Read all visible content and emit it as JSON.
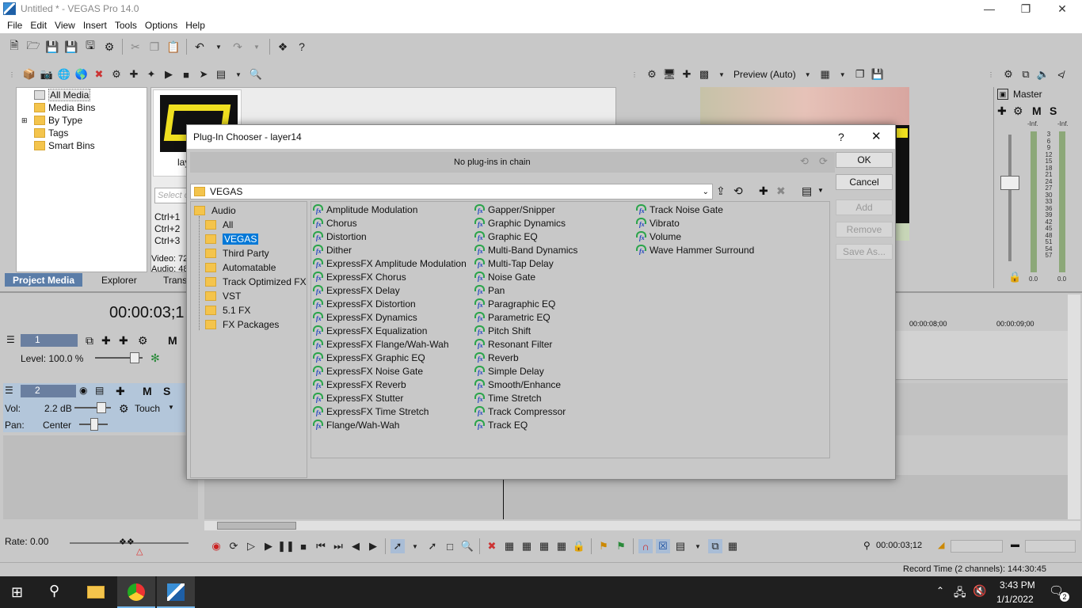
{
  "window": {
    "title": "Untitled * - VEGAS Pro 14.0"
  },
  "menu": [
    "File",
    "Edit",
    "View",
    "Insert",
    "Tools",
    "Options",
    "Help"
  ],
  "explorer": {
    "tree": [
      "All Media",
      "Media Bins",
      "By Type",
      "Tags",
      "Smart Bins"
    ],
    "thumb_label": "lay",
    "search_placeholder": "Select o",
    "shortcuts": [
      "Ctrl+1",
      "Ctrl+2",
      "Ctrl+3"
    ],
    "video_info": "Video: 72",
    "audio_info": "Audio: 48",
    "tabs": [
      "Project Media",
      "Explorer",
      "Trans"
    ]
  },
  "preview": {
    "label": "Preview (Auto)"
  },
  "master": {
    "label": "Master",
    "m": "M",
    "s": "S",
    "inf_left": "-Inf.",
    "inf_right": "-Inf.",
    "scale": [
      "3",
      "6",
      "9",
      "12",
      "15",
      "18",
      "21",
      "24",
      "27",
      "30",
      "33",
      "36",
      "39",
      "42",
      "45",
      "48",
      "51",
      "54",
      "57"
    ],
    "bottom_left": "0.0",
    "bottom_right": "0.0"
  },
  "timeline": {
    "timecode": "00:00:03;1",
    "ruler": [
      "00:00:08;00",
      "00:00:09;00"
    ],
    "track1": {
      "num": "1",
      "level": "Level: 100.0 %",
      "m": "M"
    },
    "track2": {
      "num": "2",
      "vol_label": "Vol:",
      "vol_value": "2.2 dB",
      "pan_label": "Pan:",
      "pan_value": "Center",
      "m": "M",
      "s": "S",
      "touch": "Touch"
    },
    "rate": "Rate: 0.00",
    "cursor_time": "00:00:03;12",
    "record_time": "Record Time (2 channels): 144:30:45"
  },
  "dialog": {
    "title": "Plug-In Chooser - layer14",
    "help": "?",
    "close": "✕",
    "chain_status": "No plug-ins in chain",
    "path": "VEGAS",
    "buttons": {
      "ok": "OK",
      "cancel": "Cancel",
      "add": "Add",
      "remove": "Remove",
      "save_as": "Save As..."
    },
    "tree": {
      "root": "Audio",
      "items": [
        "All",
        "VEGAS",
        "Third Party",
        "Automatable",
        "Track Optimized FX",
        "VST",
        "5.1 FX",
        "FX Packages"
      ]
    },
    "col1": [
      "Amplitude Modulation",
      "Chorus",
      "Distortion",
      "Dither",
      "ExpressFX Amplitude Modulation",
      "ExpressFX Chorus",
      "ExpressFX Delay",
      "ExpressFX Distortion",
      "ExpressFX Dynamics",
      "ExpressFX Equalization",
      "ExpressFX Flange/Wah-Wah",
      "ExpressFX Graphic EQ",
      "ExpressFX Noise Gate",
      "ExpressFX Reverb",
      "ExpressFX Stutter",
      "ExpressFX Time Stretch",
      "Flange/Wah-Wah"
    ],
    "col2": [
      "Gapper/Snipper",
      "Graphic Dynamics",
      "Graphic EQ",
      "Multi-Band Dynamics",
      "Multi-Tap Delay",
      "Noise Gate",
      "Pan",
      "Paragraphic EQ",
      "Parametric EQ",
      "Pitch Shift",
      "Resonant Filter",
      "Reverb",
      "Simple Delay",
      "Smooth/Enhance",
      "Time Stretch",
      "Track Compressor",
      "Track EQ"
    ],
    "col3": [
      "Track Noise Gate",
      "Vibrato",
      "Volume",
      "Wave Hammer Surround"
    ]
  },
  "taskbar": {
    "time": "3:43 PM",
    "date": "1/1/2022",
    "notif": "2"
  }
}
